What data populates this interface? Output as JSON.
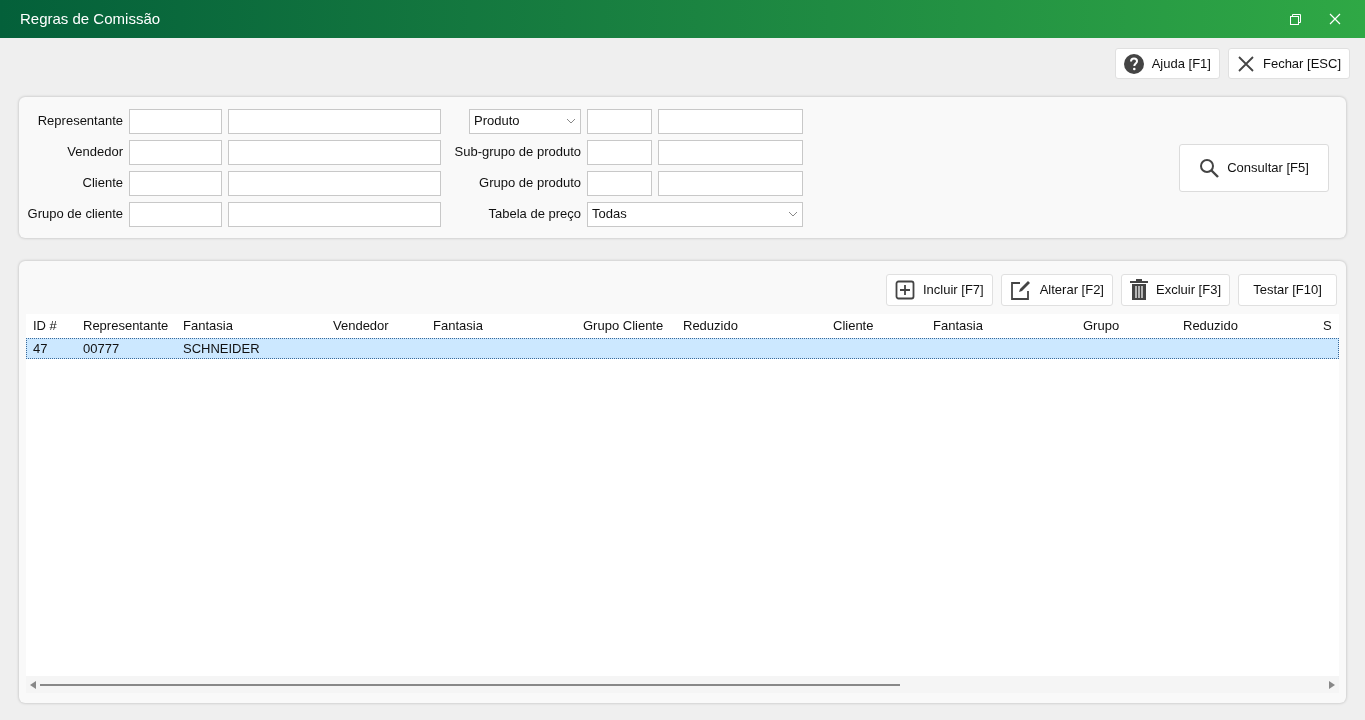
{
  "window": {
    "title": "Regras de Comissão"
  },
  "top_buttons": [
    {
      "kind": "help",
      "label": "Ajuda [F1]"
    },
    {
      "kind": "close",
      "label": "Fechar [ESC]"
    }
  ],
  "filters_left": [
    {
      "label": "Representante"
    },
    {
      "label": "Vendedor"
    },
    {
      "label": "Cliente"
    },
    {
      "label": "Grupo de cliente"
    }
  ],
  "filters_right": [
    {
      "kind": "dropdown",
      "value": "Produto"
    },
    {
      "kind": "label",
      "label": "Sub-grupo de produto"
    },
    {
      "kind": "label",
      "label": "Grupo de produto"
    },
    {
      "kind": "select",
      "label": "Tabela de preço",
      "value": "Todas"
    }
  ],
  "search_button": {
    "label": "Consultar [F5]"
  },
  "grid_buttons": [
    {
      "kind": "add",
      "label": "Incluir [F7]"
    },
    {
      "kind": "edit",
      "label": "Alterar [F2]"
    },
    {
      "kind": "delete",
      "label": "Excluir [F3]"
    },
    {
      "kind": "plain",
      "label": "Testar [F10]"
    }
  ],
  "table": {
    "columns": [
      "ID #",
      "Representante",
      "Fantasia",
      "Vendedor",
      "Fantasia",
      "Grupo Cliente",
      "Reduzido",
      "Cliente",
      "Fantasia",
      "Grupo",
      "Reduzido",
      "S"
    ],
    "rows": [
      {
        "selected": true,
        "cells": [
          "47",
          "00777",
          "SCHNEIDER"
        ]
      }
    ]
  }
}
